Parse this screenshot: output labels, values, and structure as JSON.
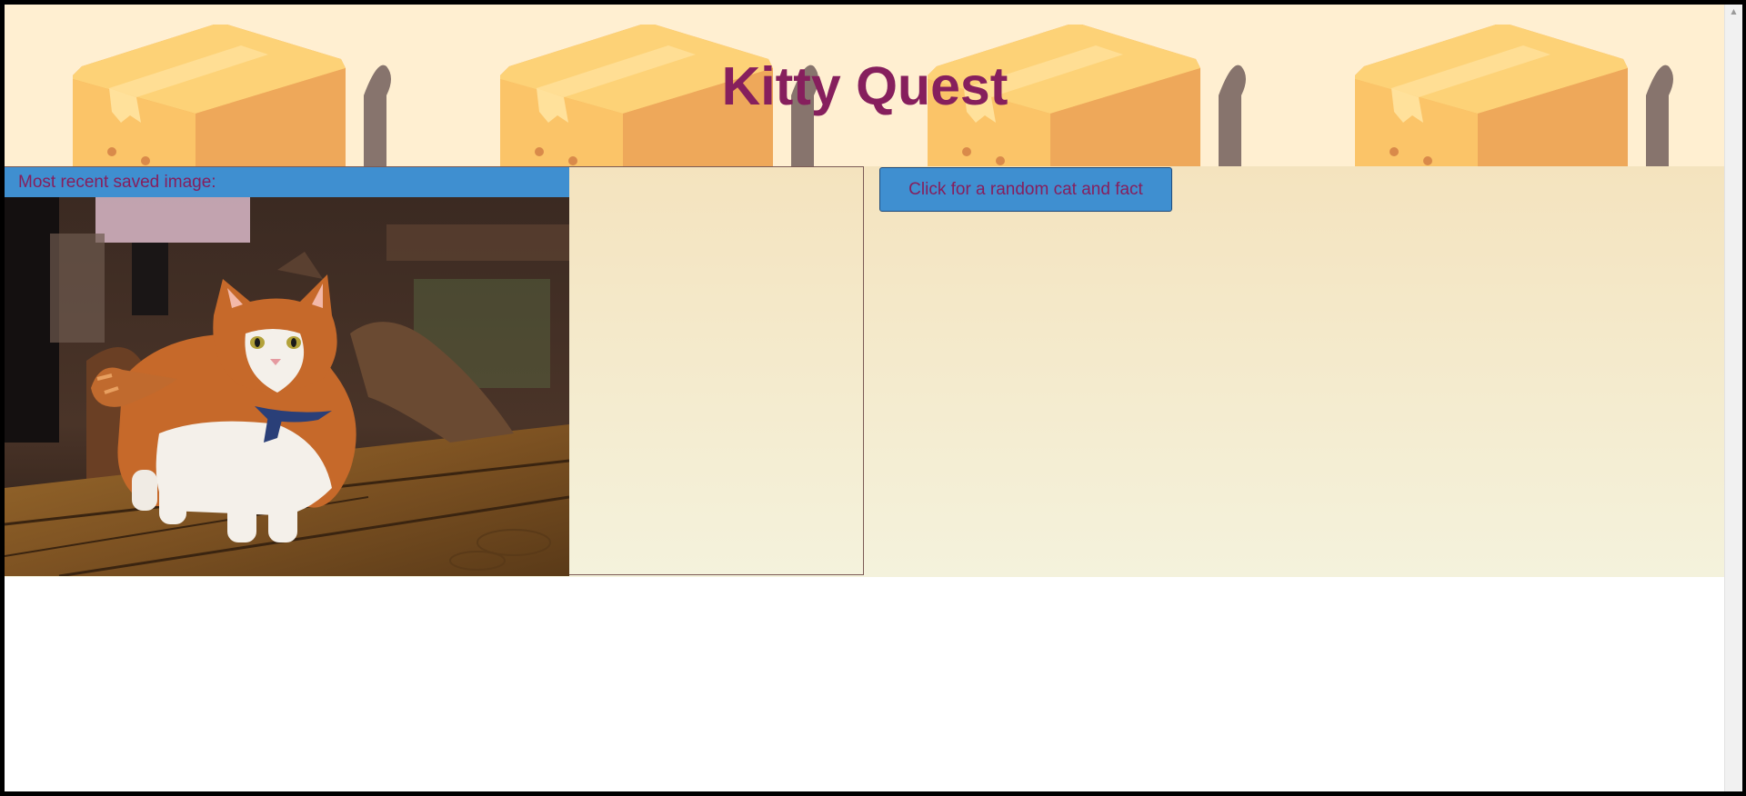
{
  "header": {
    "title": "Kitty Quest",
    "background_icon": "cat-in-box-icon"
  },
  "saved_panel": {
    "label": "Most recent saved image:",
    "image_subject": "orange-and-white-cat-on-wooden-table"
  },
  "actions": {
    "random_button_label": "Click for a random cat and fact"
  },
  "colors": {
    "title": "#861f5d",
    "accent_blue": "#3f8fd0",
    "header_bg": "#ffefd1",
    "box_light": "#fdd277",
    "box_dark": "#eea85a",
    "tail": "#87746d"
  }
}
